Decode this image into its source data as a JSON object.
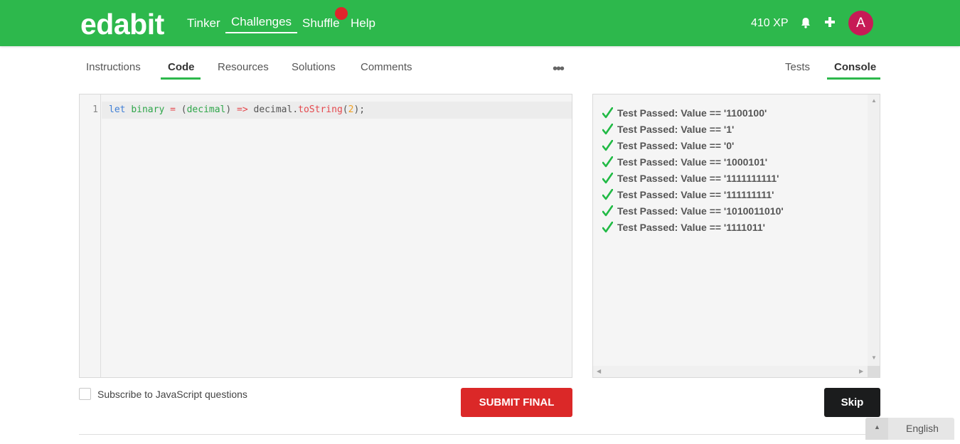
{
  "navbar": {
    "logo": "edabit",
    "links": [
      "Tinker",
      "Challenges",
      "Shuffle",
      "Help"
    ],
    "active_link": "Challenges",
    "xp": "410 XP",
    "avatar_initial": "A",
    "colors": {
      "bar": "#2db84c",
      "notification_dot": "#e0252b",
      "avatar": "#c71a56"
    },
    "icons": [
      "bell-icon",
      "plus-icon"
    ]
  },
  "tabs": {
    "left": [
      "Instructions",
      "Code",
      "Resources",
      "Solutions",
      "Comments"
    ],
    "left_active": "Code",
    "more": "•••",
    "right": [
      "Tests",
      "Console"
    ],
    "right_active": "Console"
  },
  "editor": {
    "line_number": "1",
    "code_tokens": [
      {
        "text": "let",
        "kind": "kw"
      },
      {
        "text": " ",
        "kind": "plain"
      },
      {
        "text": "binary",
        "kind": "var"
      },
      {
        "text": " ",
        "kind": "plain"
      },
      {
        "text": "=",
        "kind": "op"
      },
      {
        "text": " ",
        "kind": "plain"
      },
      {
        "text": "(",
        "kind": "pn"
      },
      {
        "text": "decimal",
        "kind": "var"
      },
      {
        "text": ")",
        "kind": "pn"
      },
      {
        "text": " ",
        "kind": "plain"
      },
      {
        "text": "=>",
        "kind": "op"
      },
      {
        "text": " ",
        "kind": "plain"
      },
      {
        "text": "decimal",
        "kind": "plain"
      },
      {
        "text": ".",
        "kind": "pn"
      },
      {
        "text": "toString",
        "kind": "fn"
      },
      {
        "text": "(",
        "kind": "pn"
      },
      {
        "text": "2",
        "kind": "num"
      },
      {
        "text": ");",
        "kind": "pn"
      }
    ]
  },
  "console": {
    "results": [
      "Test Passed: Value == '1100100'",
      "Test Passed: Value == '1'",
      "Test Passed: Value == '0'",
      "Test Passed: Value == '1000101'",
      "Test Passed: Value == '1111111111'",
      "Test Passed: Value == '111111111'",
      "Test Passed: Value == '1010011010'",
      "Test Passed: Value == '1111011'"
    ],
    "check_color": "#21ba45"
  },
  "footer": {
    "subscribe_label": "Subscribe to JavaScript questions",
    "subscribe_checked": false,
    "submit_label": "SUBMIT FINAL",
    "skip_label": "Skip",
    "language": "English"
  }
}
